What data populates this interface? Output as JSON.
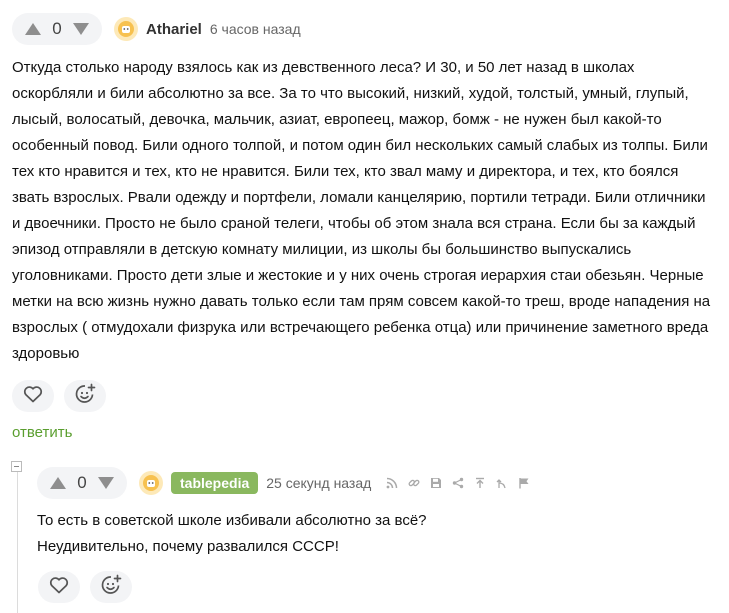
{
  "comments": [
    {
      "votes": "0",
      "username": "Athariel",
      "timestamp": "6 часов назад",
      "text": "Откуда столько народу взялось как из девственного леса? И 30, и 50 лет назад в школах оскорбляли и били абсолютно за все. За то что высокий, низкий, худой, толстый, умный, глупый, лысый, волосатый, девочка, мальчик, азиат, европеец, мажор, бомж - не нужен был какой-то особенный повод. Били одного толпой, и потом один бил нескольких самый слабых из толпы. Били тех кто нравится и тех, кто не нравится. Били тех, кто звал маму и директора, и тех, кто боялся звать взрослых. Рвали одежду и портфели, ломали канцелярию, портили тетради. Били отличники и двоечники. Просто не было сраной телеги, чтобы об этом знала вся страна. Если бы за каждый эпизод отправляли в детскую комнату милиции, из школы бы большинство выпускались уголовниками. Просто дети злые и жестокие и у них очень строгая иерархия стаи обезьян. Черные метки на всю жизнь нужно давать только если там прям совсем какой-то треш, вроде нападения на взрослых ( отмудохали физрука или встречающего ребенка отца) или причинение заметного вреда здоровью",
      "reply_label": "ответить"
    },
    {
      "votes": "0",
      "username": "tablepedia",
      "timestamp": "25 секунд назад",
      "lines": [
        "То есть в советской школе избивали абсолютно за всё?",
        "Неудивительно, почему развалился СССР!"
      ]
    }
  ],
  "icons": {
    "upvote": "triangle-up-icon",
    "downvote": "triangle-down-icon",
    "like": "heart-icon",
    "reaction": "add-emoji-icon",
    "tools": [
      "rss-icon",
      "link-icon",
      "save-icon",
      "share-icon",
      "to-top-icon",
      "parent-icon",
      "flag-icon"
    ]
  },
  "colors": {
    "reply_link": "#5a9e2f",
    "badge_bg": "#8ab85f",
    "button_bg": "#f3f4f6"
  }
}
